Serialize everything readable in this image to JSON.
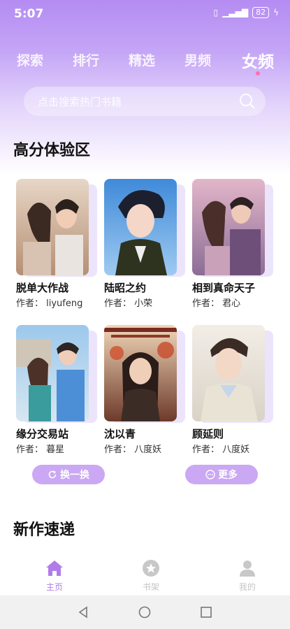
{
  "status": {
    "time": "5:07",
    "battery": "82"
  },
  "tabs": [
    {
      "label": "探索"
    },
    {
      "label": "排行"
    },
    {
      "label": "精选"
    },
    {
      "label": "男频"
    },
    {
      "label": "女频"
    }
  ],
  "search": {
    "placeholder": "点击搜索热门书籍"
  },
  "sections": {
    "high_score": "高分体验区",
    "new_works": "新作速递"
  },
  "books": [
    {
      "title": "脱单大作战",
      "author": "作者：  liyufeng"
    },
    {
      "title": "陆昭之约",
      "author": "作者：  小荣"
    },
    {
      "title": "相到真命天子",
      "author": "作者：  君心"
    },
    {
      "title": "缘分交易站",
      "author": "作者：  暮星"
    },
    {
      "title": "沈以青",
      "author": "作者：  八度妖"
    },
    {
      "title": "顾延则",
      "author": "作者：  八度妖"
    }
  ],
  "buttons": {
    "refresh": "换一换",
    "more": "更多"
  },
  "nav": [
    {
      "label": "主页"
    },
    {
      "label": "书架"
    },
    {
      "label": "我的"
    }
  ],
  "colors": {
    "accent": "#b48cf2",
    "pill": "#caa8f3",
    "active_nav": "#b07de8"
  }
}
